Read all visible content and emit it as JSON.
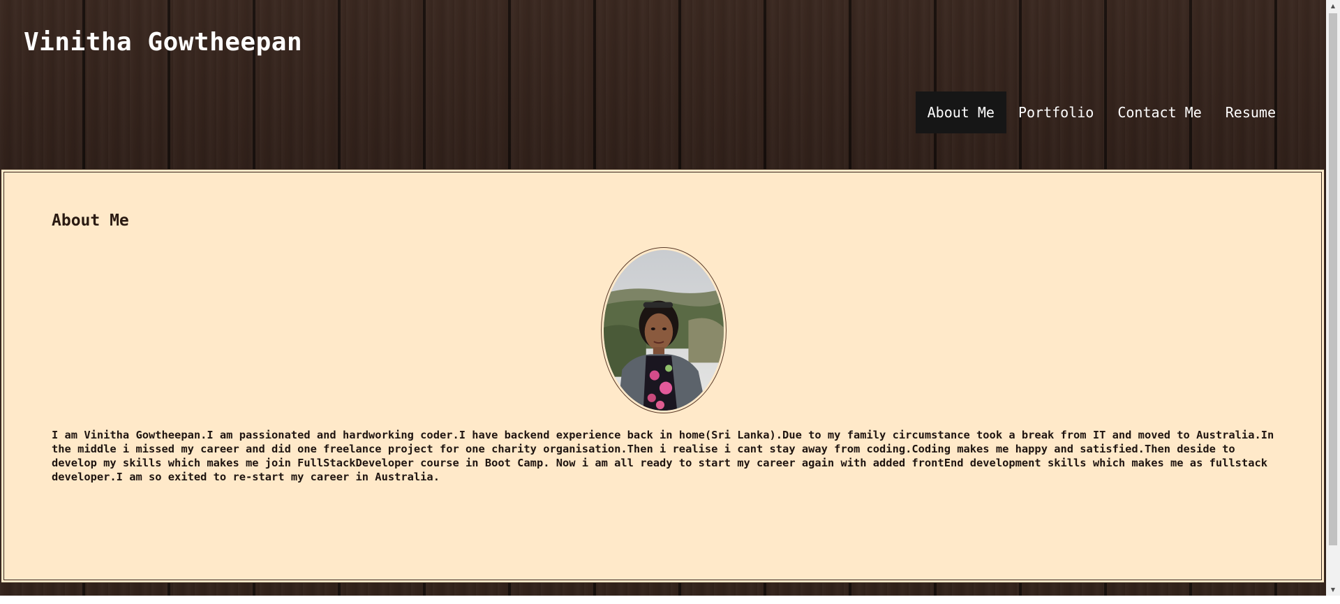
{
  "header": {
    "site_title": "Vinitha Gowtheepan"
  },
  "nav": {
    "items": [
      {
        "label": "About Me",
        "active": true
      },
      {
        "label": "Portfolio",
        "active": false
      },
      {
        "label": "Contact Me",
        "active": false
      },
      {
        "label": "Resume",
        "active": false
      }
    ]
  },
  "about": {
    "title": "About Me",
    "bio": "I am Vinitha Gowtheepan.I am passionated and hardworking coder.I have backend experience back in home(Sri Lanka).Due to my family circumstance took a break from IT and moved to Australia.In the middle i missed my career and did one freelance project for one charity organisation.Then i realise i cant stay away from coding.Coding makes me happy and satisfied.Then deside to develop my skills which makes me join FullStackDeveloper course in Boot Camp. Now i am all ready to start my career again with added frontEnd development skills which makes me as fullstack developer.I am so exited to re-start my career in Australia."
  },
  "colors": {
    "content_background": "#ffe9c9",
    "nav_active_background": "#161616",
    "header_text": "#ffffff"
  },
  "icons": {
    "scroll_up": "triangle-up-icon",
    "scroll_down": "triangle-down-icon"
  }
}
